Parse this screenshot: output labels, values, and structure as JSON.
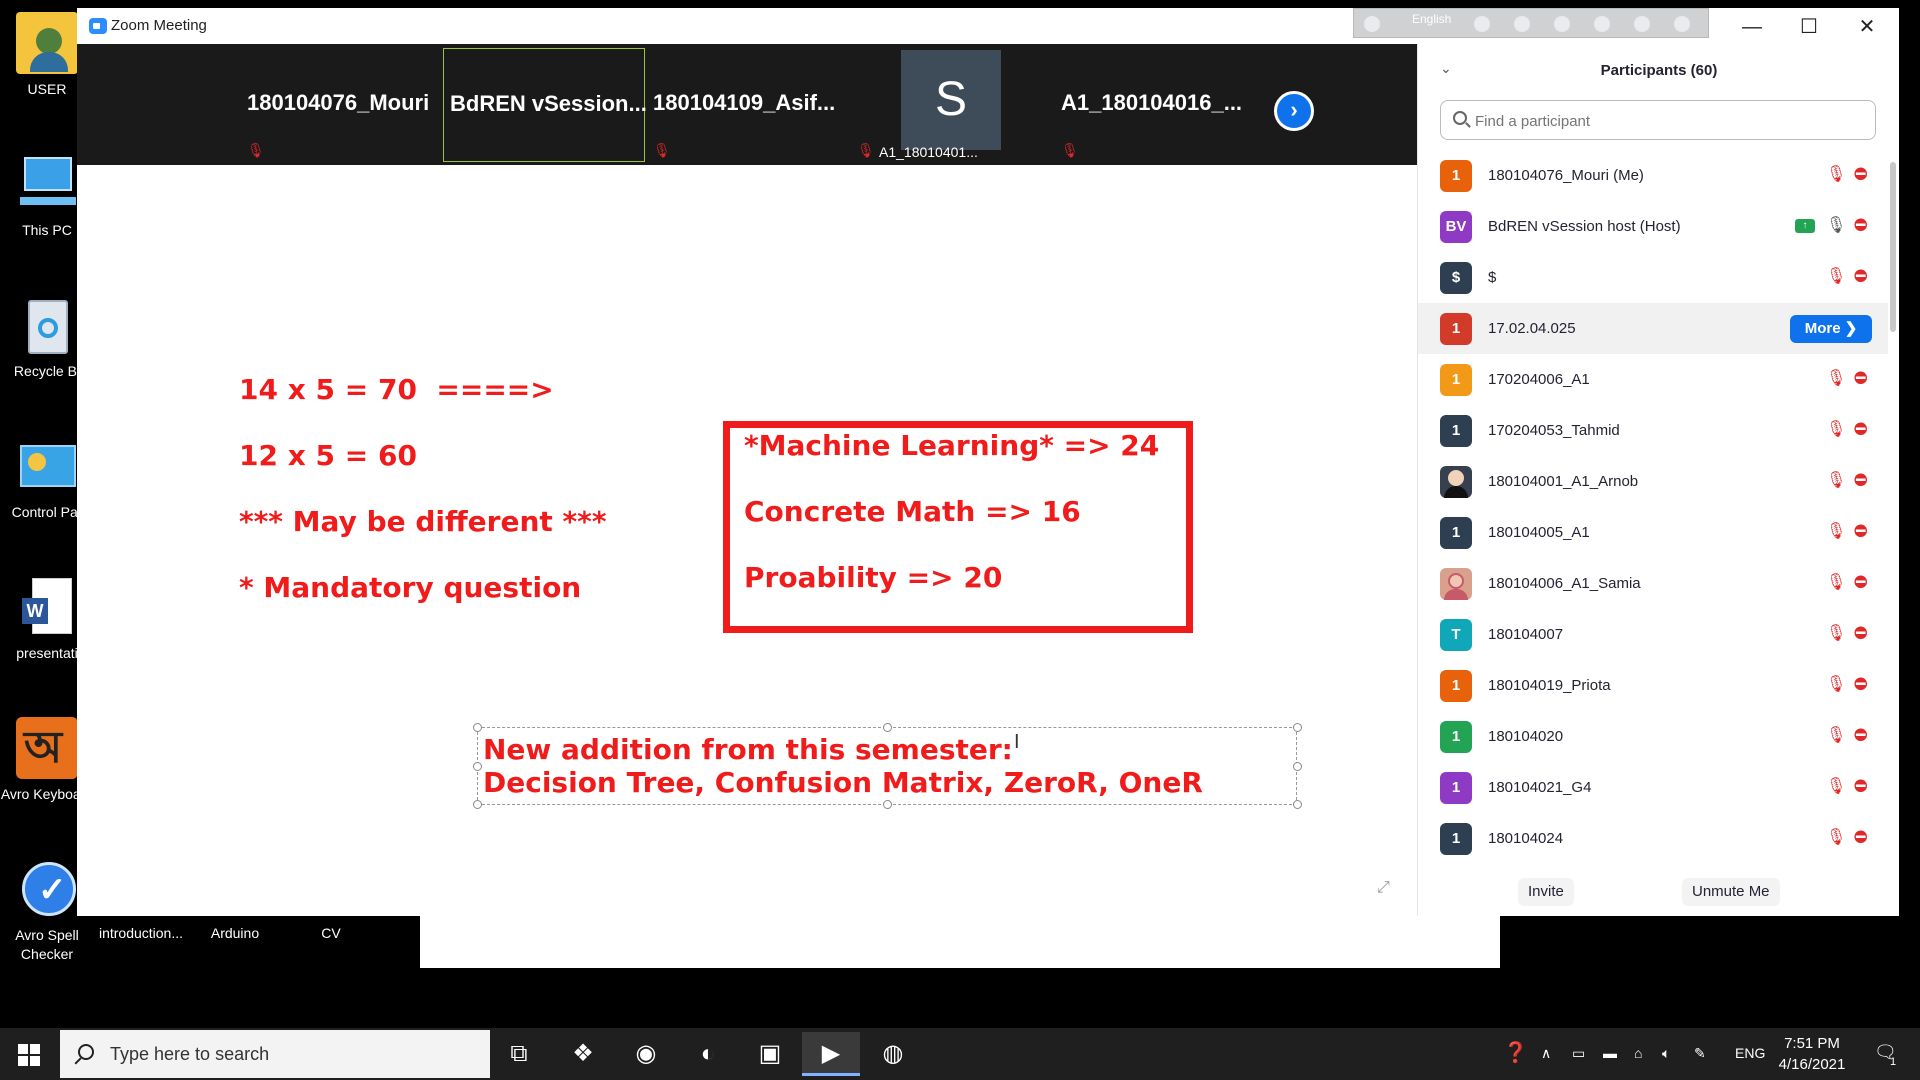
{
  "desktop": {
    "icons": [
      {
        "label": "USER"
      },
      {
        "label": "This PC"
      },
      {
        "label": "Recycle Bi"
      },
      {
        "label": "Control Par"
      },
      {
        "label": "presentati"
      },
      {
        "label": "Avro Keyboard"
      },
      {
        "label": "Avro Spell Checker"
      },
      {
        "label": "introduction..."
      },
      {
        "label": "Arduino"
      },
      {
        "label": "CV"
      }
    ]
  },
  "window": {
    "title": "Zoom Meeting",
    "language": "English",
    "controls": {
      "minimize": "—",
      "maximize": "☐",
      "close": "✕"
    }
  },
  "video_strip": {
    "tiles": [
      {
        "name": "180104076_Mouri"
      },
      {
        "name": "BdREN  vSession..."
      },
      {
        "name": "180104109_Asif..."
      },
      {
        "avatar_letter": "S",
        "sub_name": "A1_18010401..."
      },
      {
        "name": "A1_180104016_..."
      }
    ]
  },
  "whiteboard": {
    "line1": "14 x 5 = 70  ====>",
    "line2": "12 x 5 = 60",
    "line3": "*** May be different ***",
    "line4": "* Mandatory question",
    "box_line1": "*Machine Learning* => 24",
    "box_line2": "Concrete Math => 16",
    "box_line3": "Proability => 20",
    "addition_line1": "New addition from this semester:",
    "addition_line2": "Decision Tree, Confusion Matrix, ZeroR, OneR"
  },
  "participants": {
    "title": "Participants (60)",
    "search_placeholder": "Find a participant",
    "more_label": "More ❯",
    "invite_label": "Invite",
    "unmute_label": "Unmute Me",
    "list": [
      {
        "initials": "1",
        "name": "180104076_Mouri (Me)",
        "color": "#e8620c"
      },
      {
        "initials": "BV",
        "name": "BdREN vSession host (Host)",
        "color": "#8e3ac4"
      },
      {
        "initials": "$",
        "name": "$",
        "color": "#2f3f52"
      },
      {
        "initials": "1",
        "name": "17.02.04.025",
        "color": "#d23a2a"
      },
      {
        "initials": "1",
        "name": "170204006_A1",
        "color": "#f29a17"
      },
      {
        "initials": "1",
        "name": "170204053_Tahmid",
        "color": "#2f3f52"
      },
      {
        "initials": "",
        "name": "180104001_A1_Arnob",
        "color": "#36404e"
      },
      {
        "initials": "1",
        "name": "180104005_A1",
        "color": "#2f3f52"
      },
      {
        "initials": "",
        "name": "180104006_A1_Samia",
        "color": "#d9a08c"
      },
      {
        "initials": "T",
        "name": "180104007",
        "color": "#10a7b8"
      },
      {
        "initials": "1",
        "name": "180104019_Priota",
        "color": "#e8620c"
      },
      {
        "initials": "1",
        "name": "180104020",
        "color": "#23a455"
      },
      {
        "initials": "1",
        "name": "180104021_G4",
        "color": "#8e3ac4"
      },
      {
        "initials": "1",
        "name": "180104024",
        "color": "#2f3f52"
      }
    ]
  },
  "taskbar": {
    "search_placeholder": "Type here to search",
    "language": "ENG",
    "time": "7:51 PM",
    "date": "4/16/2021",
    "notification_count": "1"
  }
}
